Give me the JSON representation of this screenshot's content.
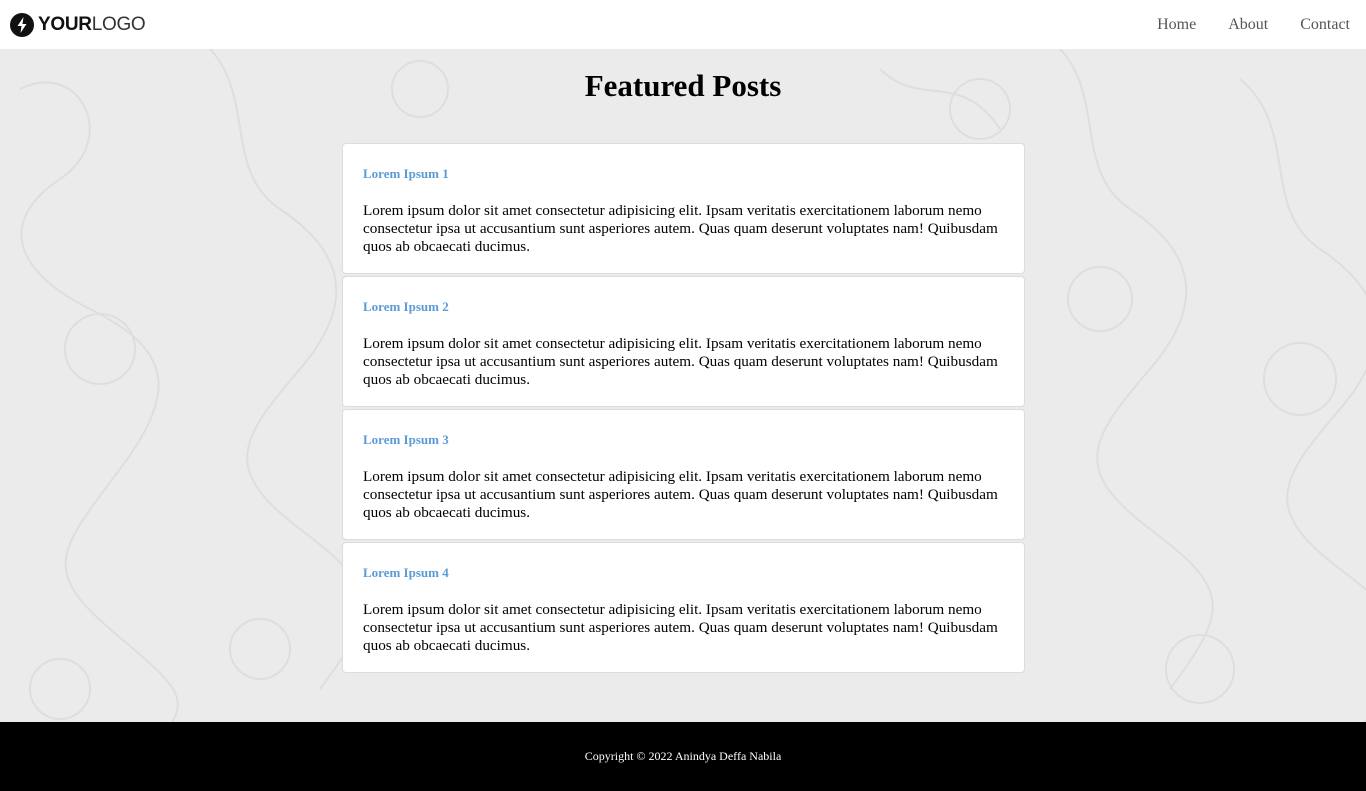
{
  "header": {
    "logo": {
      "bold": "YOUR",
      "light": "LOGO"
    },
    "nav": [
      {
        "label": "Home"
      },
      {
        "label": "About"
      },
      {
        "label": "Contact"
      }
    ]
  },
  "main": {
    "title": "Featured Posts",
    "posts": [
      {
        "title": "Lorem Ipsum 1",
        "body": "Lorem ipsum dolor sit amet consectetur adipisicing elit. Ipsam veritatis exercitationem laborum nemo consectetur ipsa ut accusantium sunt asperiores autem. Quas quam deserunt voluptates nam! Quibusdam quos ab obcaecati ducimus."
      },
      {
        "title": "Lorem Ipsum 2",
        "body": "Lorem ipsum dolor sit amet consectetur adipisicing elit. Ipsam veritatis exercitationem laborum nemo consectetur ipsa ut accusantium sunt asperiores autem. Quas quam deserunt voluptates nam! Quibusdam quos ab obcaecati ducimus."
      },
      {
        "title": "Lorem Ipsum 3",
        "body": "Lorem ipsum dolor sit amet consectetur adipisicing elit. Ipsam veritatis exercitationem laborum nemo consectetur ipsa ut accusantium sunt asperiores autem. Quas quam deserunt voluptates nam! Quibusdam quos ab obcaecati ducimus."
      },
      {
        "title": "Lorem Ipsum 4",
        "body": "Lorem ipsum dolor sit amet consectetur adipisicing elit. Ipsam veritatis exercitationem laborum nemo consectetur ipsa ut accusantium sunt asperiores autem. Quas quam deserunt voluptates nam! Quibusdam quos ab obcaecati ducimus."
      }
    ]
  },
  "footer": {
    "copyright": "Copyright © 2022 Anindya Deffa Nabila"
  },
  "colors": {
    "post_title": "#5b9bd5",
    "background": "#ebebeb",
    "footer_bg": "#000000"
  },
  "icons": {
    "logo": "lightning-bolt-icon"
  }
}
